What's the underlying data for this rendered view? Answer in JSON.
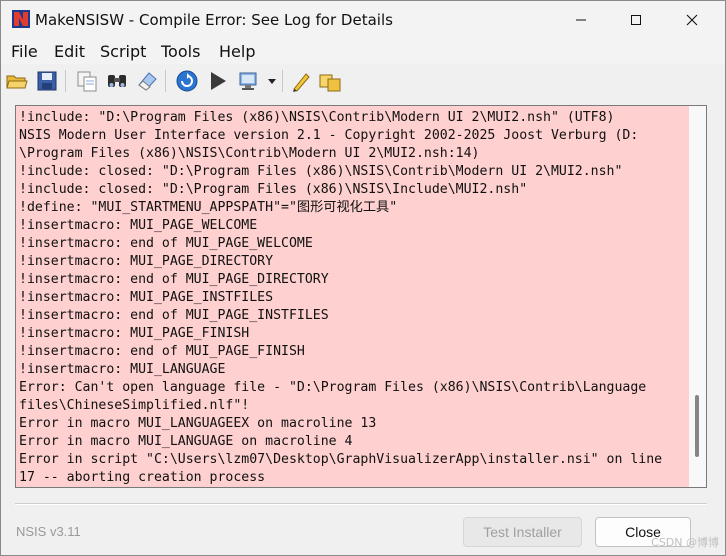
{
  "window": {
    "title": "MakeNSISW - Compile Error: See Log for Details",
    "icon": "nsis-app-icon"
  },
  "menu": {
    "items": [
      "File",
      "Edit",
      "Script",
      "Tools",
      "Help"
    ]
  },
  "toolbar": {
    "icons": [
      "open-folder-icon",
      "save-icon",
      "copy-icon",
      "find-icon",
      "clear-log-icon",
      "recompile-icon",
      "test-run-icon",
      "compressor-settings-icon",
      "edit-script-icon",
      "browse-script-icon"
    ]
  },
  "log": {
    "background_color": "#ffd0d0",
    "lines": [
      "!include: \"D:\\Program Files (x86)\\NSIS\\Contrib\\Modern UI 2\\MUI2.nsh\" (UTF8)",
      "NSIS Modern User Interface version 2.1 - Copyright 2002-2025 Joost Verburg (D:",
      "\\Program Files (x86)\\NSIS\\Contrib\\Modern UI 2\\MUI2.nsh:14)",
      "!include: closed: \"D:\\Program Files (x86)\\NSIS\\Contrib\\Modern UI 2\\MUI2.nsh\"",
      "!include: closed: \"D:\\Program Files (x86)\\NSIS\\Include\\MUI2.nsh\"",
      "!define: \"MUI_STARTMENU_APPSPATH\"=\"图形可视化工具\"",
      "!insertmacro: MUI_PAGE_WELCOME",
      "!insertmacro: end of MUI_PAGE_WELCOME",
      "!insertmacro: MUI_PAGE_DIRECTORY",
      "!insertmacro: end of MUI_PAGE_DIRECTORY",
      "!insertmacro: MUI_PAGE_INSTFILES",
      "!insertmacro: end of MUI_PAGE_INSTFILES",
      "!insertmacro: MUI_PAGE_FINISH",
      "!insertmacro: end of MUI_PAGE_FINISH",
      "!insertmacro: MUI_LANGUAGE",
      "Error: Can't open language file - \"D:\\Program Files (x86)\\NSIS\\Contrib\\Language",
      "files\\ChineseSimplified.nlf\"!",
      "Error in macro MUI_LANGUAGEEX on macroline 13",
      "Error in macro MUI_LANGUAGE on macroline 4",
      "Error in script \"C:\\Users\\lzm07\\Desktop\\GraphVisualizerApp\\installer.nsi\" on line",
      "17 -- aborting creation process"
    ]
  },
  "footer": {
    "version": "NSIS v3.11",
    "test_installer_label": "Test Installer",
    "close_label": "Close",
    "watermark": "CSDN @博博"
  }
}
